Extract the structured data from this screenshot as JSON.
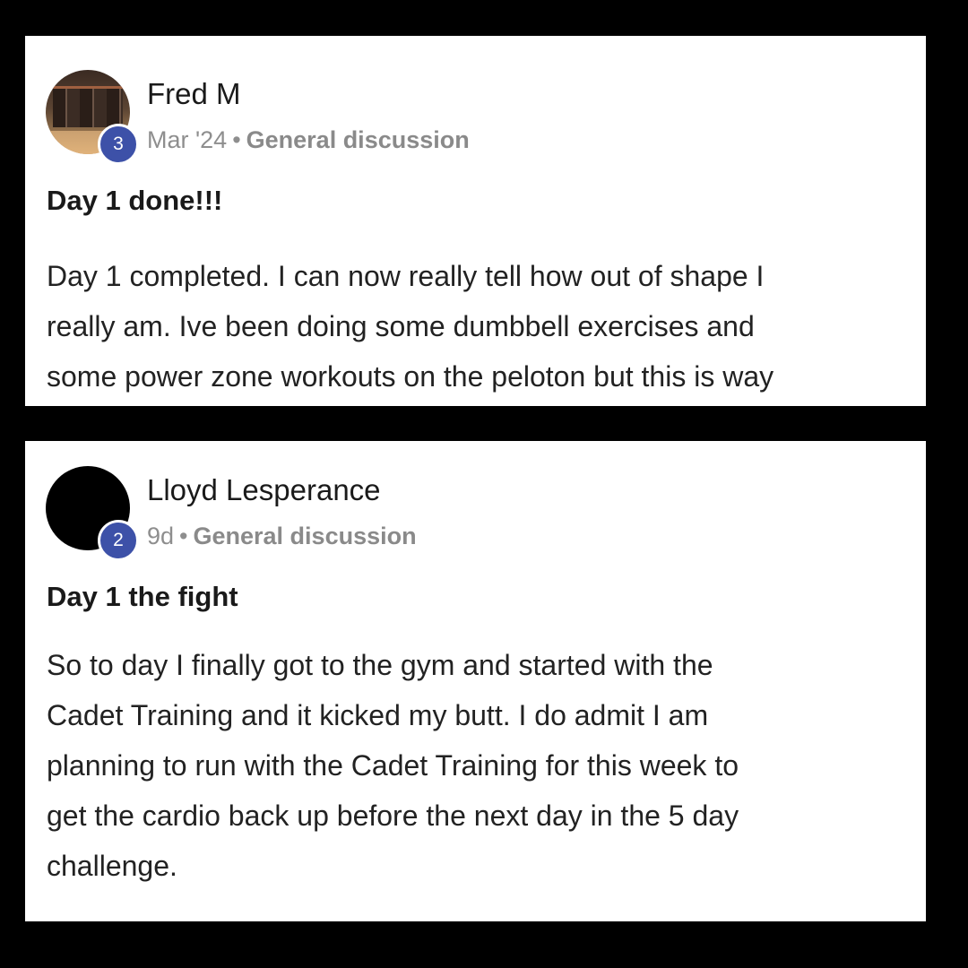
{
  "posts": [
    {
      "author": "Fred M",
      "level": "3",
      "time": "Mar '24",
      "separator": "•",
      "category": "General discussion",
      "title": "Day 1 done!!!",
      "body_lines": [
        "Day 1 completed. I can now really tell how out of shape I",
        "really am. Ive been doing some dumbbell exercises and",
        "some power zone workouts on the peloton but this is way"
      ]
    },
    {
      "author": "Lloyd Lesperance",
      "level": "2",
      "time": "9d",
      "separator": "•",
      "category": "General discussion",
      "title": "Day 1 the fight",
      "body_lines": [
        "So to day I finally got to the gym and started with the",
        "Cadet Training and it kicked my butt. I do admit I am",
        "planning to run with the Cadet Training for this week to",
        "get the cardio back up before the next day in the 5 day",
        "challenge."
      ]
    }
  ],
  "colors": {
    "background": "#000000",
    "card": "#ffffff",
    "badge": "#3d51a8",
    "meta_text": "#8e8e8e"
  },
  "icons": {
    "post_1_avatar": "user-photo-avatar",
    "post_2_avatar": "user-black-avatar"
  }
}
